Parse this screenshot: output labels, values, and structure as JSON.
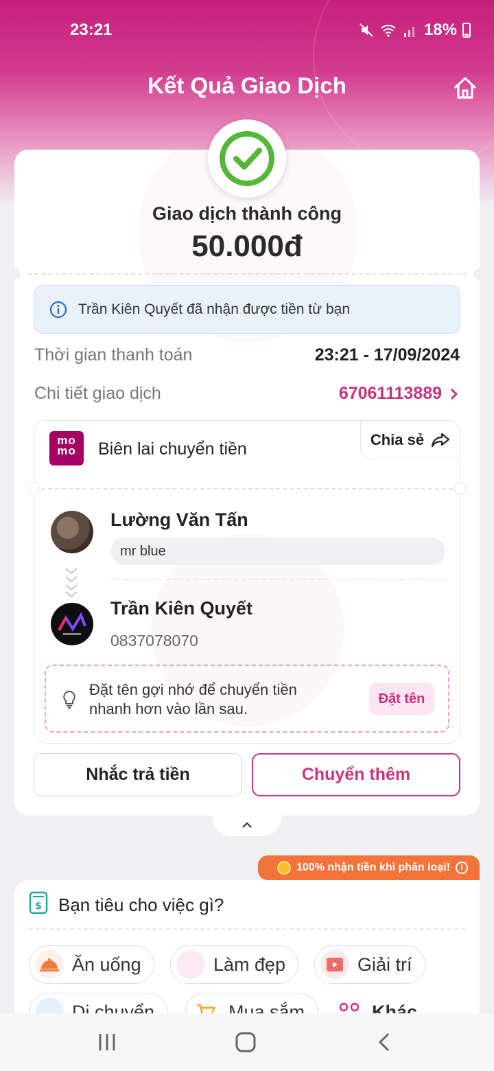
{
  "status": {
    "time": "23:21",
    "battery": "18%"
  },
  "header": {
    "title": "Kết Quả Giao Dịch"
  },
  "result": {
    "status_text": "Giao dịch thành công",
    "amount": "50.000đ"
  },
  "notice": {
    "text": "Trần Kiên Quyết đã nhận được tiền từ bạn"
  },
  "details": {
    "time_label": "Thời gian thanh toán",
    "time_value": "23:21 - 17/09/2024",
    "id_label": "Chi tiết giao dịch",
    "id_value": "67061113889"
  },
  "receipt": {
    "logo_top": "mo",
    "logo_bottom": "mo",
    "title": "Biên lai chuyển tiền",
    "share_label": "Chia sẻ",
    "sender": {
      "name": "Lường Văn Tấn",
      "memo": "mr blue"
    },
    "receiver": {
      "name": "Trần Kiên Quyết",
      "phone": "0837078070"
    },
    "hint": {
      "text": "Đặt tên gợi nhớ để chuyển tiền nhanh hơn vào lần sau.",
      "button": "Đặt tên"
    }
  },
  "actions": {
    "remind": "Nhắc trả tiền",
    "send_more": "Chuyển thêm"
  },
  "promo": {
    "text": "100% nhận tiền khi phân loại!"
  },
  "categories": {
    "title": "Bạn tiêu cho việc gì?",
    "items": [
      "Ăn uống",
      "Làm đẹp",
      "Giải trí",
      "Di chuyển",
      "Mua sắm",
      "Khác"
    ]
  },
  "colors": {
    "brand": "#c9357f",
    "momo": "#a50064",
    "promo": "#f3743a",
    "success": "#56b63a"
  }
}
